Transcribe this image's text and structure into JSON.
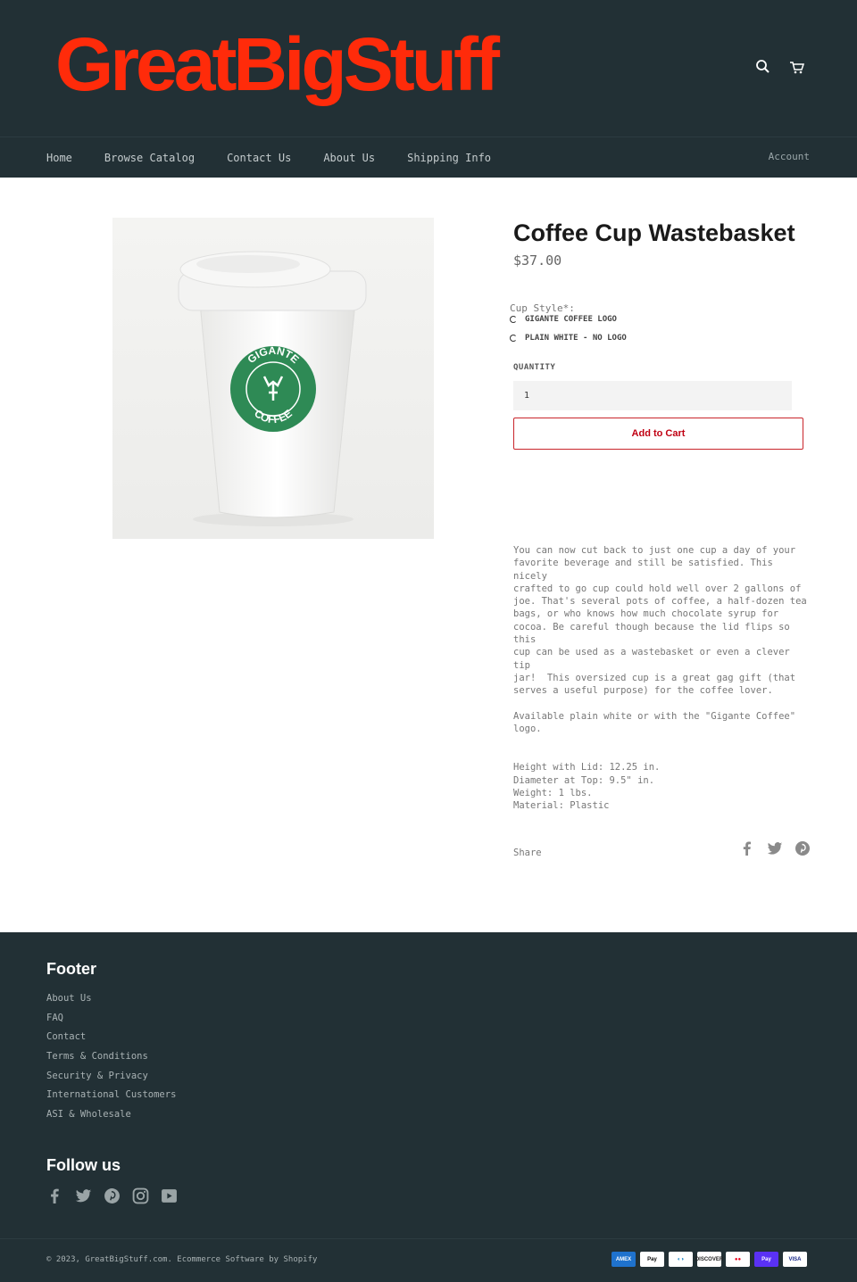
{
  "header": {
    "logo_text": "GreatBigStuff",
    "logo_color": "#ff2b0a",
    "icons": [
      "search-icon",
      "cart-icon"
    ],
    "nav": [
      {
        "label": "Home"
      },
      {
        "label": "Browse Catalog"
      },
      {
        "label": "Contact Us"
      },
      {
        "label": "About Us"
      },
      {
        "label": "Shipping Info"
      }
    ],
    "account_label": "Account"
  },
  "product": {
    "image_alt": "Gigante Coffee cup wastebasket",
    "logo_text_top": "GIGANTE",
    "logo_text_bottom": "COFFEE",
    "title": "Coffee Cup Wastebasket",
    "price": "$37.00",
    "option_label": "Cup Style*:",
    "options": [
      {
        "label": "GIGANTE COFFEE LOGO"
      },
      {
        "label": "PLAIN WHITE - NO LOGO"
      }
    ],
    "quantity_label": "QUANTITY",
    "quantity_value": "1",
    "add_to_cart_label": "Add to Cart",
    "accent_color": "#c00012",
    "description": "You can now cut back to just one cup a day of your\nfavorite beverage and still be satisfied. This nicely\ncrafted to go cup could hold well over 2 gallons of\njoe. That's several pots of coffee, a half-dozen tea\nbags, or who knows how much chocolate syrup for\ncocoa. Be careful though because the lid flips so this\ncup can be used as a wastebasket or even a clever tip\njar!  This oversized cup is a great gag gift (that\nserves a useful purpose) for the coffee lover.\n\nAvailable plain white or with the \"Gigante Coffee\"\nlogo.",
    "specs": "Height with Lid: 12.25 in.\nDiameter at Top: 9.5\" in.\nWeight: 1 lbs.\nMaterial: Plastic",
    "share_label": "Share",
    "share_icons": [
      "facebook-icon",
      "twitter-icon",
      "pinterest-icon"
    ]
  },
  "footer": {
    "title": "Footer",
    "links": [
      {
        "label": "About Us"
      },
      {
        "label": "FAQ"
      },
      {
        "label": "Contact"
      },
      {
        "label": "Terms & Conditions"
      },
      {
        "label": "Security & Privacy"
      },
      {
        "label": "International Customers"
      },
      {
        "label": "ASI & Wholesale"
      }
    ],
    "follow_title": "Follow us",
    "social_icons": [
      "facebook-icon",
      "twitter-icon",
      "pinterest-icon",
      "instagram-icon",
      "youtube-icon"
    ],
    "copyright": "© 2023, GreatBigStuff.com. Ecommerce Software by Shopify",
    "payments": [
      {
        "name": "amex",
        "label": "AMEX",
        "bg": "#1f72cd",
        "fg": "#ffffff"
      },
      {
        "name": "apple-pay",
        "label": " Pay",
        "bg": "#ffffff",
        "fg": "#000000"
      },
      {
        "name": "diners",
        "label": "◐◑",
        "bg": "#ffffff",
        "fg": "#0079be"
      },
      {
        "name": "discover",
        "label": "DISCOVER",
        "bg": "#ffffff",
        "fg": "#222222"
      },
      {
        "name": "mastercard",
        "label": "●●",
        "bg": "#ffffff",
        "fg": "#eb001b"
      },
      {
        "name": "shop-pay",
        "label": "Pay",
        "bg": "#5a31f4",
        "fg": "#ffffff"
      },
      {
        "name": "visa",
        "label": "VISA",
        "bg": "#ffffff",
        "fg": "#142688"
      }
    ]
  }
}
